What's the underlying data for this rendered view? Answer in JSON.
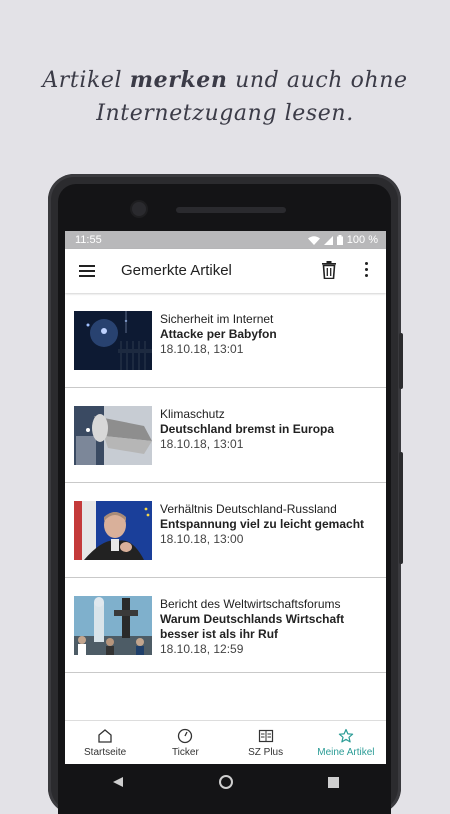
{
  "promo": {
    "line1_pre": "Artikel ",
    "line1_bold": "merken",
    "line1_post": " und auch ohne",
    "line2": "Internetzugang lesen."
  },
  "status": {
    "time": "11:55",
    "battery": "100 %"
  },
  "appbar": {
    "title": "Gemerkte Artikel",
    "menu_icon": "hamburger-menu-icon",
    "delete_icon": "trash-icon",
    "more_icon": "more-vert-icon"
  },
  "articles": [
    {
      "kicker": "Sicherheit im Internet",
      "headline": "Attacke per Babyfon",
      "date": "18.10.18, 13:01"
    },
    {
      "kicker": "Klimaschutz",
      "headline": "Deutschland bremst in Europa",
      "date": "18.10.18, 13:01"
    },
    {
      "kicker": "Verhältnis Deutschland-Russland",
      "headline": "Entspannung viel zu leicht gemacht",
      "date": "18.10.18, 13:00"
    },
    {
      "kicker": "Bericht des Weltwirtschaftsforums",
      "headline": "Warum Deutschlands Wirtschaft besser ist als ihr Ruf",
      "date": "18.10.18, 12:59"
    }
  ],
  "nav": [
    {
      "label": "Startseite",
      "icon": "home-icon"
    },
    {
      "label": "Ticker",
      "icon": "clock-icon"
    },
    {
      "label": "SZ Plus",
      "icon": "newspaper-icon"
    },
    {
      "label": "Meine Artikel",
      "icon": "star-icon"
    }
  ],
  "colors": {
    "accent": "#2b9c96",
    "background": "#e3e2e7",
    "statusbar": "#b8b8ba"
  }
}
